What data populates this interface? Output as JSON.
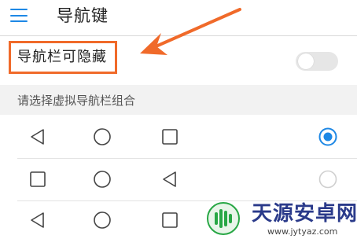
{
  "header": {
    "title": "导航键",
    "menu_icon": "hamburger-menu-icon"
  },
  "hide_setting": {
    "label": "导航栏可隐藏",
    "toggle_state": "off",
    "highlight_color": "#f06a2a"
  },
  "section": {
    "label": "请选择虚拟导航栏组合"
  },
  "combinations": [
    {
      "buttons": [
        "back-triangle-icon",
        "home-circle-icon",
        "recents-square-icon"
      ],
      "selected": true
    },
    {
      "buttons": [
        "recents-square-icon",
        "home-circle-icon",
        "back-triangle-icon"
      ],
      "selected": false
    },
    {
      "buttons": [
        "back-triangle-icon",
        "home-circle-icon",
        "recents-square-icon"
      ],
      "selected": false
    }
  ],
  "colors": {
    "accent": "#1e88e5",
    "arrow": "#f06a2a",
    "watermark_text": "#2a3a8a",
    "watermark_logo": "#28a745"
  },
  "watermark": {
    "text": "天源安卓网",
    "url": "www.jytyaz.com"
  }
}
